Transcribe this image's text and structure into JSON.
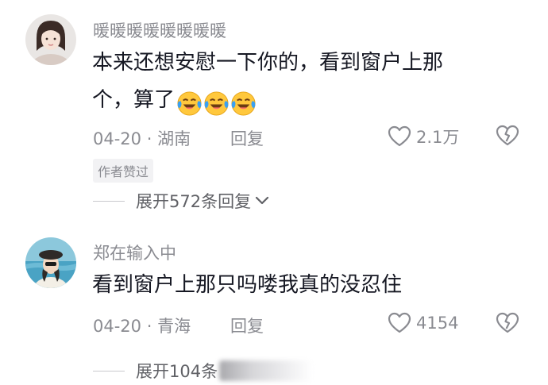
{
  "comments": [
    {
      "username": "暖暖暖暖暖暖暖暖",
      "text_line1": "本来还想安慰一下你的，看到窗户上那",
      "text_line2": "个，算了",
      "date": "04-20",
      "separator": "·",
      "location": "湖南",
      "reply_label": "回复",
      "likes": "2.1万",
      "author_liked_badge": "作者赞过",
      "expand_label": "展开572条回复",
      "emoji_names": [
        "laughing-crying-emoji",
        "laughing-crying-emoji",
        "laughing-crying-emoji"
      ]
    },
    {
      "username": "郑在输入中",
      "text_line1": "看到窗户上那只吗喽我真的没忍住",
      "date": "04-20",
      "separator": "·",
      "location": "青海",
      "reply_label": "回复",
      "likes": "4154",
      "expand_label": "展开104条"
    }
  ],
  "colors": {
    "text_primary": "#161823",
    "text_secondary": "#8a8b91",
    "badge_bg": "#f2f2f4",
    "divider": "#c9c9cd"
  },
  "icons": [
    "heart-outline-icon",
    "broken-heart-icon",
    "chevron-down-icon"
  ]
}
